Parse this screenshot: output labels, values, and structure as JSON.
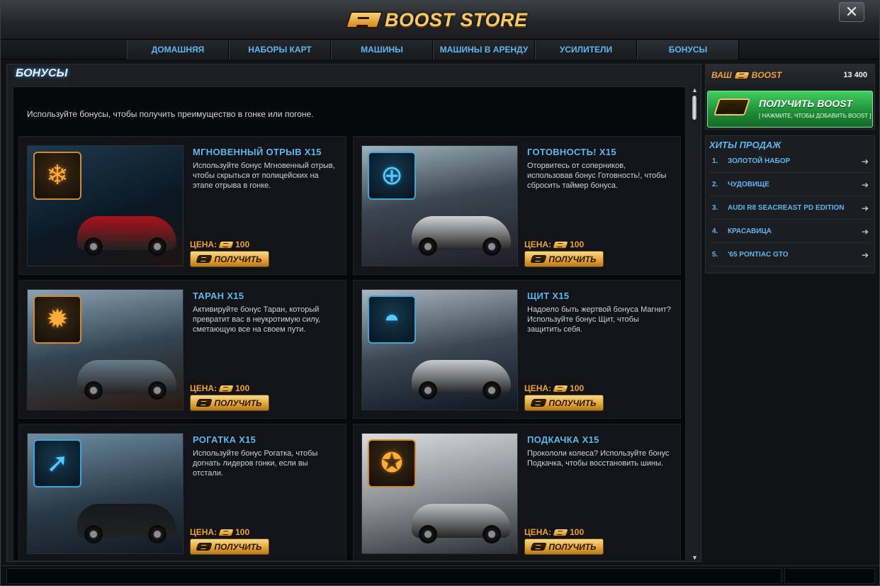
{
  "window": {
    "title_logo": "BOOST STORE",
    "close_glyph": "✕"
  },
  "nav": [
    {
      "label": "ДОМАШНЯЯ СТРАНИЦА"
    },
    {
      "label": "НАБОРЫ КАРТ"
    },
    {
      "label": "МАШИНЫ"
    },
    {
      "label": "МАШИНЫ В АРЕНДУ"
    },
    {
      "label": "УСИЛИТЕЛИ"
    },
    {
      "label": "БОНУСЫ",
      "active": true
    }
  ],
  "main": {
    "title": "БОНУСЫ",
    "intro": "Используйте бонусы, чтобы получить преимущество в гонке или погоне.",
    "price_label": "ЦЕНА:",
    "buy_label": "ПОЛУЧИТЬ",
    "cards": [
      {
        "title": "МГНОВЕННЫЙ ОТРЫВ X15",
        "desc": "Используйте бонус Мгновенный отрыв, чтобы скрыться от полицейских на этапе отрыва в гонке.",
        "price": "100",
        "icon": "snowflake-shield-icon",
        "glyph": "❄",
        "badge": "orange",
        "car_color": "#b3121a"
      },
      {
        "title": "ГОТОВНОСТЬ! X15",
        "desc": "Оторвитесь от соперников, использовав бонус Готовность!, чтобы сбросить таймер бонуса.",
        "price": "100",
        "icon": "timer-reset-icon",
        "glyph": "⊕",
        "badge": "blue",
        "car_color": "#d9dadb"
      },
      {
        "title": "ТАРАН X15",
        "desc": "Активируйте бонус Таран, который превратит вас в неукротимую силу, сметающую все на своем пути.",
        "price": "100",
        "icon": "ram-icon",
        "glyph": "✹",
        "badge": "orange",
        "car_color": "#6a7f8c"
      },
      {
        "title": "ЩИТ X15",
        "desc": "Надоело быть жертвой бонуса Магнит? Используйте бонус Щит, чтобы защитить себя.",
        "price": "100",
        "icon": "shield-dome-icon",
        "glyph": "◓",
        "badge": "blue",
        "car_color": "#d0d3d6"
      },
      {
        "title": "РОГАТКА X15",
        "desc": "Используйте бонус Рогатка, чтобы догнать лидеров гонки, если вы отстали.",
        "price": "100",
        "icon": "slingshot-arrow-icon",
        "glyph": "➚",
        "badge": "blue",
        "car_color": "#151719"
      },
      {
        "title": "ПОДКАЧКА X15",
        "desc": "Прокололи колеса? Используйте бонус Подкачка, чтобы восстановить шины.",
        "price": "100",
        "icon": "tire-icon",
        "glyph": "✪",
        "badge": "orange",
        "car_color": "#bfc3c7"
      }
    ]
  },
  "sidebar": {
    "boost_label": "ВАШ",
    "boost_word": "BOOST",
    "boost_amount": "13 400",
    "get_boost_title": "ПОЛУЧИТЬ",
    "get_boost_word": "BOOST",
    "get_boost_sub": "[ НАЖМИТЕ, ЧТОБЫ ДОБАВИТЬ BOOST ]",
    "hits_title": "ХИТЫ ПРОДАЖ",
    "hits": [
      {
        "num": "1.",
        "name": "ЗОЛОТОЙ НАБОР"
      },
      {
        "num": "2.",
        "name": "ЧУДОВИЩЕ"
      },
      {
        "num": "3.",
        "name": "AUDI R8 SEACREAST PD EDITION"
      },
      {
        "num": "4.",
        "name": "КРАСАВИЦА"
      },
      {
        "num": "5.",
        "name": "'65 PONTIAC GTO"
      }
    ]
  },
  "colors": {
    "accent_blue": "#5fb6f0",
    "accent_orange": "#f0a23a",
    "green_button": "#2aa846"
  }
}
